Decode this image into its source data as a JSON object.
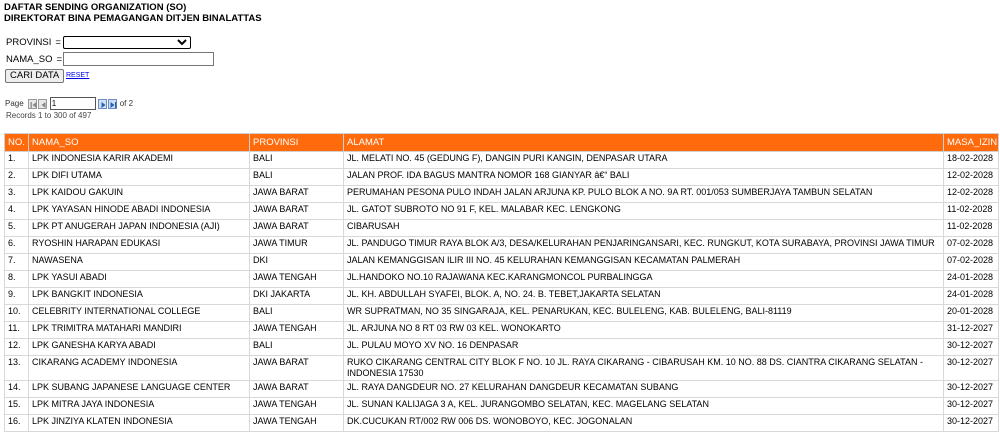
{
  "header": {
    "line1": "DAFTAR SENDING ORGANIZATION (SO)",
    "line2": "DIREKTORAT BINA PEMAGANGAN DITJEN BINALATTAS"
  },
  "form": {
    "provinsi_label": "PROVINSI",
    "provinsi_sep": "=",
    "provinsi_value": "",
    "nama_label": "NAMA_SO",
    "nama_sep": "=",
    "nama_value": "",
    "cari_label": "CARI DATA",
    "reset_label": "RESET"
  },
  "pager": {
    "page_label": "Page",
    "page_value": "1",
    "of_label": "of 2",
    "records_text": "Records 1 to 300 of 497"
  },
  "table": {
    "headers": [
      "NO.",
      "NAMA_SO",
      "PROVINSI",
      "ALAMAT",
      "MASA_IZIN"
    ],
    "rows": [
      [
        "1.",
        "LPK INDONESIA KARIR AKADEMI",
        "BALI",
        "JL. MELATI NO. 45 (GEDUNG F), DANGIN PURI KANGIN, DENPASAR UTARA",
        "18-02-2028"
      ],
      [
        "2.",
        "LPK DIFI UTAMA",
        "BALI",
        "JALAN PROF. IDA BAGUS MANTRA NOMOR 168 GIANYAR â€“ BALI",
        "12-02-2028"
      ],
      [
        "3.",
        "LPK KAIDOU GAKUIN",
        "JAWA BARAT",
        "PERUMAHAN PESONA PULO INDAH JALAN ARJUNA KP. PULO BLOK A NO. 9A RT. 001/053 SUMBERJAYA TAMBUN SELATAN",
        "12-02-2028"
      ],
      [
        "4.",
        "LPK YAYASAN HINODE ABADI INDONESIA",
        "JAWA BARAT",
        "JL. GATOT SUBROTO NO 91 F, KEL. MALABAR KEC. LENGKONG",
        "11-02-2028"
      ],
      [
        "5.",
        "LPK PT ANUGERAH JAPAN INDONESIA (AJI)",
        "JAWA BARAT",
        "CIBARUSAH",
        "11-02-2028"
      ],
      [
        "6.",
        "RYOSHIN HARAPAN EDUKASI",
        "JAWA TIMUR",
        "JL. PANDUGO TIMUR RAYA BLOK A/3, DESA/KELURAHAN PENJARINGANSARI, KEC. RUNGKUT, KOTA SURABAYA, PROVINSI JAWA TIMUR",
        "07-02-2028"
      ],
      [
        "7.",
        "NAWASENA",
        "DKI",
        "JALAN KEMANGGISAN ILIR III NO. 45 KELURAHAN KEMANGGISAN KECAMATAN PALMERAH",
        "07-02-2028"
      ],
      [
        "8.",
        "LPK YASUI ABADI",
        "JAWA TENGAH",
        "JL.HANDOKO NO.10 RAJAWANA KEC.KARANGMONCOL PURBALINGGA",
        "24-01-2028"
      ],
      [
        "9.",
        "LPK BANGKIT INDONESIA",
        "DKI JAKARTA",
        "JL. KH. ABDULLAH SYAFEI, BLOK. A, NO. 24. B. TEBET,JAKARTA SELATAN",
        "24-01-2028"
      ],
      [
        "10.",
        "CELEBRITY INTERNATIONAL COLLEGE",
        "BALI",
        "WR SUPRATMAN, NO 35 SINGARAJA, KEL. PENARUKAN, KEC. BULELENG, KAB. BULELENG, BALI-81119",
        "20-01-2028"
      ],
      [
        "11.",
        "LPK TRIMITRA MATAHARI MANDIRI",
        "JAWA TENGAH",
        "JL. ARJUNA NO 8 RT 03 RW 03 KEL. WONOKARTO",
        "31-12-2027"
      ],
      [
        "12.",
        "LPK GANESHA KARYA ABADI",
        "BALI",
        "JL. PULAU MOYO XV NO. 16 DENPASAR",
        "30-12-2027"
      ],
      [
        "13.",
        "CIKARANG ACADEMY INDONESIA",
        "JAWA BARAT",
        "RUKO CIKARANG CENTRAL CITY BLOK F NO. 10 JL. RAYA CIKARANG - CIBARUSAH KM. 10 NO. 88 DS. CIANTRA CIKARANG SELATAN - INDONESIA 17530",
        "30-12-2027"
      ],
      [
        "14.",
        "LPK SUBANG JAPANESE LANGUAGE CENTER",
        "JAWA BARAT",
        "JL. RAYA DANGDEUR NO. 27 KELURAHAN DANGDEUR KECAMATAN SUBANG",
        "30-12-2027"
      ],
      [
        "15.",
        "LPK MITRA JAYA INDONESIA",
        "JAWA TENGAH",
        "JL. SUNAN KALIJAGA 3 A, KEL. JURANGOMBO SELATAN, KEC. MAGELANG SELATAN",
        "30-12-2027"
      ],
      [
        "16.",
        "LPK JINZIYA KLATEN INDONESIA",
        "JAWA TENGAH",
        "DK.CUCUKAN RT/002 RW 006 DS. WONOBOYO, KEC. JOGONALAN",
        "30-12-2027"
      ]
    ]
  },
  "colors": {
    "header_bg": "#ff6a0d",
    "header_text": "#ffffff",
    "link": "#0000ee"
  },
  "icons": [
    "first-page-icon",
    "prev-page-icon",
    "next-page-icon",
    "last-page-icon"
  ]
}
